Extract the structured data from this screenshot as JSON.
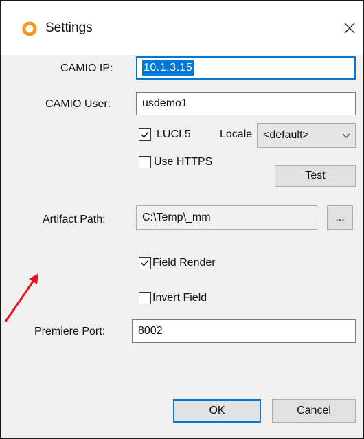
{
  "window": {
    "title": "Settings",
    "icon": "camio-ring-icon",
    "close_glyph": "✕"
  },
  "form": {
    "camio_ip": {
      "label": "CAMIO IP:",
      "value": "10.1.3.15"
    },
    "camio_user": {
      "label": "CAMIO User:",
      "value": "usdemo1"
    },
    "luci5": {
      "label": "LUCI 5",
      "checked": true
    },
    "locale": {
      "label": "Locale",
      "selected": "<default>"
    },
    "use_https": {
      "label": "Use HTTPS",
      "checked": false
    },
    "test_button": "Test",
    "artifact_path": {
      "label": "Artifact Path:",
      "value": "C:\\Temp\\_mm",
      "browse_label": "..."
    },
    "field_render": {
      "label": "Field Render",
      "checked": true
    },
    "invert_field": {
      "label": "Invert Field",
      "checked": false
    },
    "premiere_port": {
      "label": "Premiere Port:",
      "value": "8002"
    }
  },
  "buttons": {
    "ok": "OK",
    "cancel": "Cancel"
  },
  "colors": {
    "accent": "#0078d7",
    "icon_orange": "#f7941d",
    "annotation_red": "#e8141b"
  }
}
